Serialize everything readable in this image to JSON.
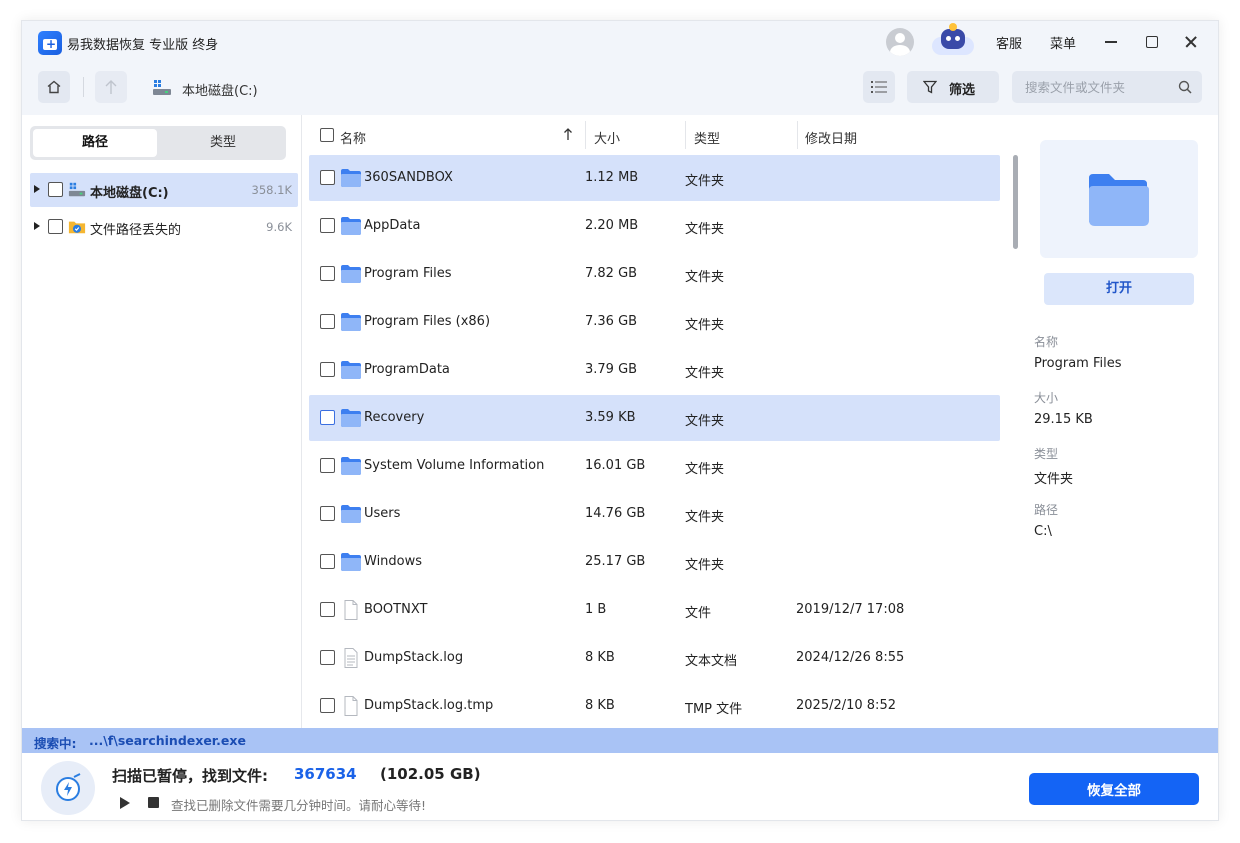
{
  "app": {
    "title": "易我数据恢复 专业版 终身",
    "support_label": "客服",
    "menu_label": "菜单"
  },
  "nav": {
    "breadcrumb": "本地磁盘(C:)",
    "filter_label": "筛选",
    "search_placeholder": "搜索文件或文件夹"
  },
  "left": {
    "tabs": [
      {
        "label": "路径",
        "active": true
      },
      {
        "label": "类型",
        "active": false
      }
    ],
    "tree": [
      {
        "label": "本地磁盘(C:)",
        "count": "358.1K",
        "selected": true,
        "icon": "local-disk-icon"
      },
      {
        "label": "文件路径丢失的",
        "count": "9.6K",
        "selected": false,
        "icon": "lost-path-folder-icon"
      }
    ]
  },
  "list": {
    "headers": {
      "name": "名称",
      "size": "大小",
      "type": "类型",
      "modified": "修改日期"
    },
    "rows": [
      {
        "name": "360SANDBOX",
        "size": "1.12 MB",
        "type": "文件夹",
        "modified": "",
        "icon": "folder-icon",
        "state": "selected"
      },
      {
        "name": "AppData",
        "size": "2.20 MB",
        "type": "文件夹",
        "modified": "",
        "icon": "folder-icon",
        "state": ""
      },
      {
        "name": "Program Files",
        "size": "7.82 GB",
        "type": "文件夹",
        "modified": "",
        "icon": "folder-icon",
        "state": ""
      },
      {
        "name": "Program Files (x86)",
        "size": "7.36 GB",
        "type": "文件夹",
        "modified": "",
        "icon": "folder-icon",
        "state": ""
      },
      {
        "name": "ProgramData",
        "size": "3.79 GB",
        "type": "文件夹",
        "modified": "",
        "icon": "folder-icon",
        "state": ""
      },
      {
        "name": "Recovery",
        "size": "3.59 KB",
        "type": "文件夹",
        "modified": "",
        "icon": "folder-icon",
        "state": "selected focus"
      },
      {
        "name": "System Volume Information",
        "size": "16.01 GB",
        "type": "文件夹",
        "modified": "",
        "icon": "folder-icon",
        "state": ""
      },
      {
        "name": "Users",
        "size": "14.76 GB",
        "type": "文件夹",
        "modified": "",
        "icon": "folder-icon",
        "state": ""
      },
      {
        "name": "Windows",
        "size": "25.17 GB",
        "type": "文件夹",
        "modified": "",
        "icon": "folder-icon",
        "state": ""
      },
      {
        "name": "BOOTNXT",
        "size": "1 B",
        "type": "文件",
        "modified": "2019/12/7 17:08",
        "icon": "file-icon",
        "state": ""
      },
      {
        "name": "DumpStack.log",
        "size": "8 KB",
        "type": "文本文档",
        "modified": "2024/12/26 8:55",
        "icon": "text-file-icon",
        "state": ""
      },
      {
        "name": "DumpStack.log.tmp",
        "size": "8 KB",
        "type": "TMP 文件",
        "modified": "2025/2/10 8:52",
        "icon": "file-icon",
        "state": ""
      }
    ]
  },
  "preview": {
    "open_label": "打开",
    "props": [
      {
        "label": "名称",
        "value": "Program Files"
      },
      {
        "label": "大小",
        "value": "29.15 KB"
      },
      {
        "label": "类型",
        "value": "文件夹"
      },
      {
        "label": "路径",
        "value": "C:\\"
      }
    ]
  },
  "status": {
    "searching_label": "搜索中:",
    "searching_path": "...\\f\\searchindexer.exe"
  },
  "footer": {
    "scan_title": "扫描已暂停，找到文件:",
    "found_count": "367634",
    "found_size": "(102.05 GB)",
    "hint": "查找已删除文件需要几分钟时间。请耐心等待!",
    "recover_all_label": "恢复全部"
  },
  "colors": {
    "accent": "#1464f5",
    "selected_row": "#d5e1fa",
    "status_strip": "#a9c3f5"
  }
}
